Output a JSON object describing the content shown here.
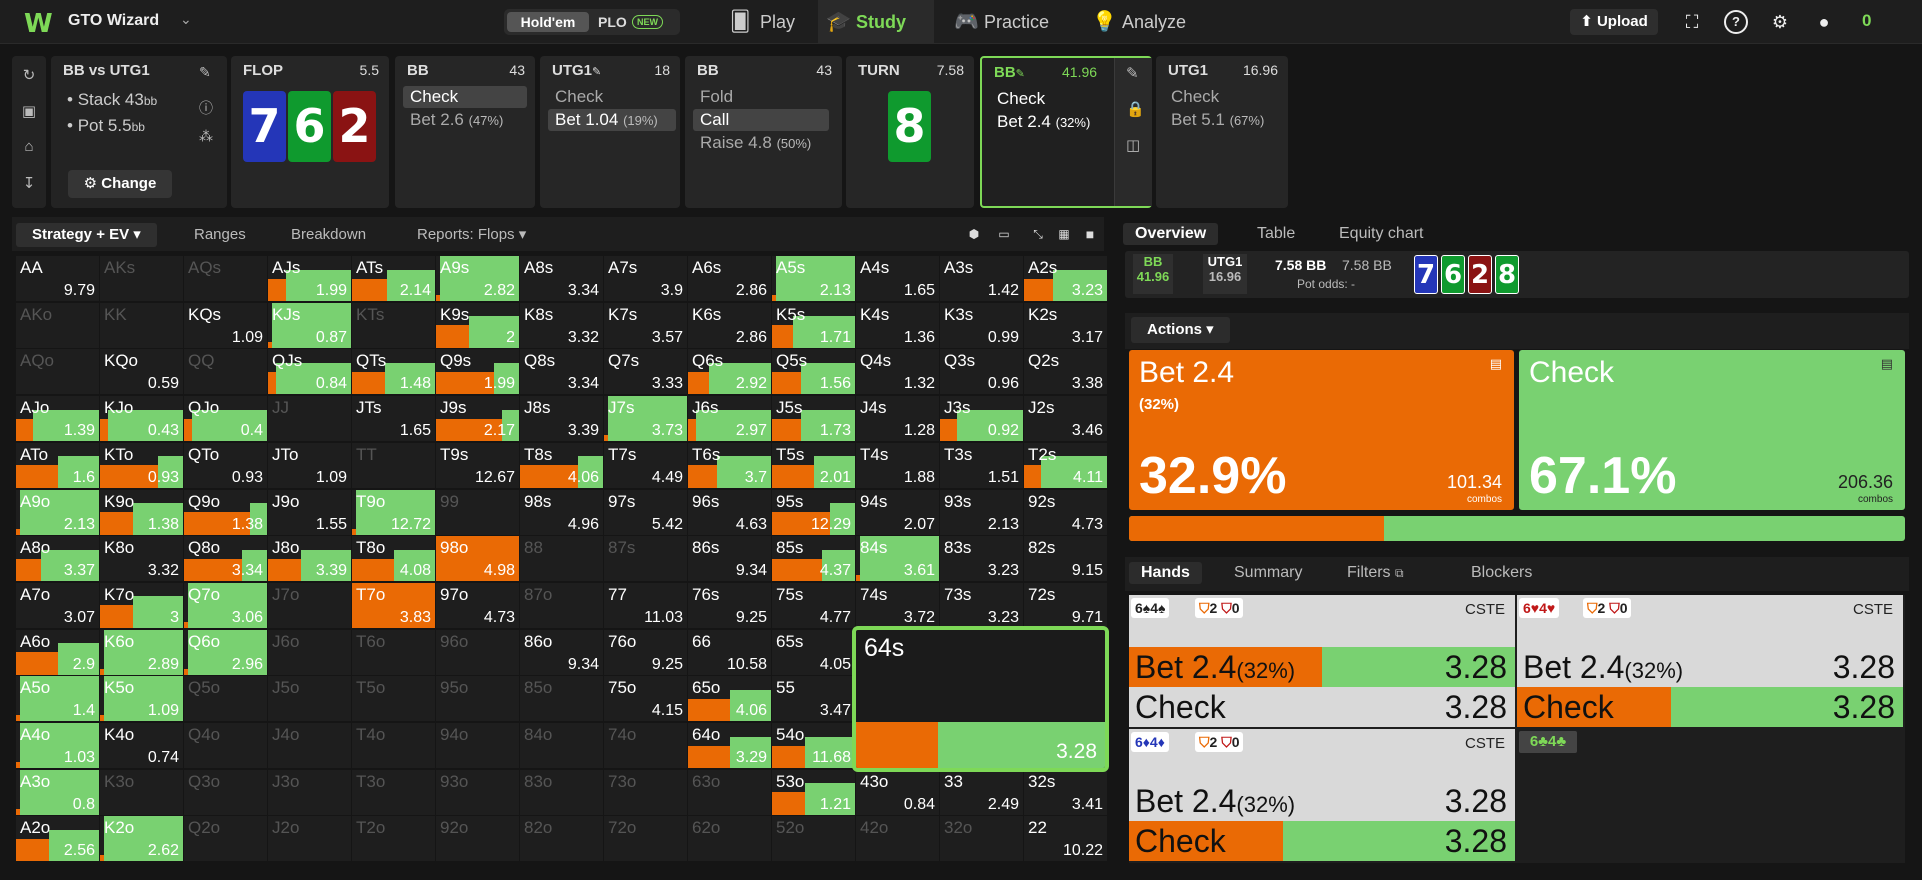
{
  "app": {
    "title": "GTO Wizard",
    "logo": "W"
  },
  "game_toggle": {
    "active": "Hold'em",
    "other": "PLO",
    "badge": "NEW"
  },
  "nav": [
    {
      "label": "Play"
    },
    {
      "label": "Study"
    },
    {
      "label": "Practice"
    },
    {
      "label": "Analyze"
    }
  ],
  "topright": {
    "upload": "Upload",
    "balance": "0"
  },
  "spot": {
    "title": "BB vs UTG1",
    "stack_label": "Stack 43",
    "stack_unit": "bb",
    "pot_label": "Pot 5.5",
    "pot_unit": "bb",
    "change": "Change"
  },
  "streets": [
    {
      "header": "FLOP",
      "value": "5.5"
    },
    {
      "header": "BB",
      "value": "43",
      "actions": [
        {
          "label": "Check",
          "pct": ""
        },
        {
          "label": "Bet 2.6",
          "pct": "(47%)"
        }
      ]
    },
    {
      "header": "UTG1",
      "value": "18",
      "actions": [
        {
          "label": "Check",
          "pct": ""
        },
        {
          "label": "Bet 1.04",
          "pct": "(19%)"
        }
      ]
    },
    {
      "header": "BB",
      "value": "43",
      "actions": [
        {
          "label": "Fold",
          "pct": ""
        },
        {
          "label": "Call",
          "pct": ""
        },
        {
          "label": "Raise 4.8",
          "pct": "(50%)"
        }
      ]
    },
    {
      "header": "TURN",
      "value": "7.58"
    },
    {
      "header": "BB",
      "value": "41.96",
      "actions": [
        {
          "label": "Check",
          "pct": ""
        },
        {
          "label": "Bet 2.4",
          "pct": "(32%)"
        }
      ]
    },
    {
      "header": "UTG1",
      "value": "16.96",
      "actions": [
        {
          "label": "Check",
          "pct": ""
        },
        {
          "label": "Bet 5.1",
          "pct": "(67%)"
        }
      ]
    }
  ],
  "board": {
    "flop": [
      "7",
      "6",
      "2"
    ],
    "turn": "8"
  },
  "left_tabs": {
    "strategy": "Strategy + EV",
    "ranges": "Ranges",
    "breakdown": "Breakdown",
    "reports": "Reports: Flops"
  },
  "grid": [
    [
      "AA",
      1,
      0,
      "9.79"
    ],
    [
      "AKs",
      0,
      0,
      ""
    ],
    [
      "AQs",
      0,
      0,
      ""
    ],
    [
      "AJs",
      1,
      0.22,
      "1.99"
    ],
    [
      "ATs",
      1,
      0.42,
      "2.14"
    ],
    [
      "A9s",
      1,
      0.05,
      "2.82"
    ],
    [
      "A8s",
      1,
      0,
      "3.34"
    ],
    [
      "A7s",
      1,
      0,
      "3.9"
    ],
    [
      "A6s",
      1,
      0,
      "2.86"
    ],
    [
      "A5s",
      1,
      0.05,
      "2.13"
    ],
    [
      "A4s",
      1,
      0,
      "1.65"
    ],
    [
      "A3s",
      1,
      0,
      "1.42"
    ],
    [
      "A2s",
      1,
      0.35,
      "3.23"
    ],
    [
      "AKo",
      0,
      0,
      ""
    ],
    [
      "KK",
      0,
      0,
      ""
    ],
    [
      "KQs",
      1,
      0,
      "1.09"
    ],
    [
      "KJs",
      1,
      0.05,
      "0.87"
    ],
    [
      "KTs",
      0,
      0,
      ""
    ],
    [
      "K9s",
      1,
      0.4,
      "2"
    ],
    [
      "K8s",
      1,
      0,
      "3.32"
    ],
    [
      "K7s",
      1,
      0,
      "3.57"
    ],
    [
      "K6s",
      1,
      0,
      "2.86"
    ],
    [
      "K5s",
      1,
      0.25,
      "1.71"
    ],
    [
      "K4s",
      1,
      0,
      "1.36"
    ],
    [
      "K3s",
      1,
      0,
      "0.99"
    ],
    [
      "K2s",
      1,
      0,
      "3.17"
    ],
    [
      "AQo",
      0,
      0,
      ""
    ],
    [
      "KQo",
      1,
      0,
      "0.59"
    ],
    [
      "QQ",
      0,
      0,
      ""
    ],
    [
      "QJs",
      1,
      0.1,
      "0.84"
    ],
    [
      "QTs",
      1,
      0.4,
      "1.48"
    ],
    [
      "Q9s",
      1,
      0.7,
      "1.99"
    ],
    [
      "Q8s",
      1,
      0,
      "3.34"
    ],
    [
      "Q7s",
      1,
      0,
      "3.33"
    ],
    [
      "Q6s",
      1,
      0.25,
      "2.92"
    ],
    [
      "Q5s",
      1,
      0.35,
      "1.56"
    ],
    [
      "Q4s",
      1,
      0,
      "1.32"
    ],
    [
      "Q3s",
      1,
      0,
      "0.96"
    ],
    [
      "Q2s",
      1,
      0,
      "3.38"
    ],
    [
      "AJo",
      1,
      0.2,
      "1.39"
    ],
    [
      "KJo",
      1,
      0.1,
      "0.43"
    ],
    [
      "QJo",
      1,
      0.1,
      "0.4"
    ],
    [
      "JJ",
      0,
      0,
      ""
    ],
    [
      "JTs",
      1,
      0,
      "1.65"
    ],
    [
      "J9s",
      1,
      0.8,
      "2.17"
    ],
    [
      "J8s",
      1,
      0,
      "3.39"
    ],
    [
      "J7s",
      1,
      0.05,
      "3.73"
    ],
    [
      "J6s",
      1,
      0.1,
      "2.97"
    ],
    [
      "J5s",
      1,
      0.35,
      "1.73"
    ],
    [
      "J4s",
      1,
      0,
      "1.28"
    ],
    [
      "J3s",
      1,
      0.2,
      "0.92"
    ],
    [
      "J2s",
      1,
      0,
      "3.46"
    ],
    [
      "ATo",
      1,
      0.5,
      "1.6"
    ],
    [
      "KTo",
      1,
      0.7,
      "0.93"
    ],
    [
      "QTo",
      1,
      0,
      "0.93"
    ],
    [
      "JTo",
      1,
      0,
      "1.09"
    ],
    [
      "TT",
      0,
      0,
      ""
    ],
    [
      "T9s",
      1,
      0,
      "12.67"
    ],
    [
      "T8s",
      1,
      0.7,
      "4.06"
    ],
    [
      "T7s",
      1,
      0,
      "4.49"
    ],
    [
      "T6s",
      1,
      0.35,
      "3.7"
    ],
    [
      "T5s",
      1,
      0.5,
      "2.01"
    ],
    [
      "T4s",
      1,
      0,
      "1.88"
    ],
    [
      "T3s",
      1,
      0,
      "1.51"
    ],
    [
      "T2s",
      1,
      0.2,
      "4.11"
    ],
    [
      "A9o",
      1,
      0.05,
      "2.13"
    ],
    [
      "K9o",
      1,
      0.4,
      "1.38"
    ],
    [
      "Q9o",
      1,
      0.8,
      "1.38"
    ],
    [
      "J9o",
      1,
      0,
      "1.55"
    ],
    [
      "T9o",
      1,
      0.05,
      "12.72"
    ],
    [
      "99",
      0,
      0,
      ""
    ],
    [
      "98s",
      1,
      0,
      "4.96"
    ],
    [
      "97s",
      1,
      0,
      "5.42"
    ],
    [
      "96s",
      1,
      0,
      "4.63"
    ],
    [
      "95s",
      1,
      0.7,
      "12.29"
    ],
    [
      "94s",
      1,
      0,
      "2.07"
    ],
    [
      "93s",
      1,
      0,
      "2.13"
    ],
    [
      "92s",
      1,
      0,
      "4.73"
    ],
    [
      "A8o",
      1,
      0.3,
      "3.37"
    ],
    [
      "K8o",
      1,
      0,
      "3.32"
    ],
    [
      "Q8o",
      1,
      0.7,
      "3.34"
    ],
    [
      "J8o",
      1,
      0.4,
      "3.39"
    ],
    [
      "T8o",
      1,
      0.5,
      "4.08"
    ],
    [
      "98o",
      1,
      1,
      "4.98"
    ],
    [
      "88",
      0,
      0,
      ""
    ],
    [
      "87s",
      0,
      0,
      ""
    ],
    [
      "86s",
      1,
      0,
      "9.34"
    ],
    [
      "85s",
      1,
      0.6,
      "4.37"
    ],
    [
      "84s",
      1,
      0.05,
      "3.61"
    ],
    [
      "83s",
      1,
      0,
      "3.23"
    ],
    [
      "82s",
      1,
      0,
      "9.15"
    ],
    [
      "A7o",
      1,
      0,
      "3.07"
    ],
    [
      "K7o",
      1,
      0.4,
      "3"
    ],
    [
      "Q7o",
      1,
      0.05,
      "3.06"
    ],
    [
      "J7o",
      0,
      0,
      ""
    ],
    [
      "T7o",
      1,
      1,
      "3.83"
    ],
    [
      "97o",
      1,
      0,
      "4.73"
    ],
    [
      "87o",
      0,
      0,
      ""
    ],
    [
      "77",
      1,
      0,
      "11.03"
    ],
    [
      "76s",
      1,
      0,
      "9.25"
    ],
    [
      "75s",
      1,
      0,
      "4.77"
    ],
    [
      "74s",
      1,
      0,
      "3.72"
    ],
    [
      "73s",
      1,
      0,
      "3.23"
    ],
    [
      "72s",
      1,
      0,
      "9.71"
    ],
    [
      "A6o",
      1,
      0.5,
      "2.9"
    ],
    [
      "K6o",
      1,
      0.05,
      "2.89"
    ],
    [
      "Q6o",
      1,
      0.05,
      "2.96"
    ],
    [
      "J6o",
      0,
      0,
      ""
    ],
    [
      "T6o",
      0,
      0,
      ""
    ],
    [
      "96o",
      0,
      0,
      ""
    ],
    [
      "86o",
      1,
      0,
      "9.34"
    ],
    [
      "76o",
      1,
      0,
      "9.25"
    ],
    [
      "66",
      1,
      0,
      "10.58"
    ],
    [
      "65s",
      1,
      0,
      "4.05"
    ],
    [
      "64s",
      1,
      0.33,
      "3.28"
    ],
    [
      "63s",
      1,
      0,
      ""
    ],
    [
      "62s",
      1,
      0,
      ""
    ],
    [
      "A5o",
      1,
      0.05,
      "1.4"
    ],
    [
      "K5o",
      1,
      0.05,
      "1.09"
    ],
    [
      "Q5o",
      0,
      0,
      ""
    ],
    [
      "J5o",
      0,
      0,
      ""
    ],
    [
      "T5o",
      0,
      0,
      ""
    ],
    [
      "95o",
      0,
      0,
      ""
    ],
    [
      "85o",
      0,
      0,
      ""
    ],
    [
      "75o",
      1,
      0,
      "4.15"
    ],
    [
      "65o",
      1,
      0.5,
      "4.06"
    ],
    [
      "55",
      1,
      0,
      "3.47"
    ],
    [
      "54s",
      1,
      0,
      ""
    ],
    [
      "53s",
      1,
      0,
      ""
    ],
    [
      "52s",
      1,
      0,
      ""
    ],
    [
      "A4o",
      1,
      0.05,
      "1.03"
    ],
    [
      "K4o",
      1,
      0,
      "0.74"
    ],
    [
      "Q4o",
      0,
      0,
      ""
    ],
    [
      "J4o",
      0,
      0,
      ""
    ],
    [
      "T4o",
      0,
      0,
      ""
    ],
    [
      "94o",
      0,
      0,
      ""
    ],
    [
      "84o",
      0,
      0,
      ""
    ],
    [
      "74o",
      0,
      0,
      ""
    ],
    [
      "64o",
      1,
      0.5,
      "3.29"
    ],
    [
      "54o",
      1,
      0.4,
      "11.68"
    ],
    [
      "44",
      1,
      0,
      ""
    ],
    [
      "43s",
      1,
      0,
      ""
    ],
    [
      "42s",
      1,
      0,
      ""
    ],
    [
      "A3o",
      1,
      0.05,
      "0.8"
    ],
    [
      "K3o",
      0,
      0,
      ""
    ],
    [
      "Q3o",
      0,
      0,
      ""
    ],
    [
      "J3o",
      0,
      0,
      ""
    ],
    [
      "T3o",
      0,
      0,
      ""
    ],
    [
      "93o",
      0,
      0,
      ""
    ],
    [
      "83o",
      0,
      0,
      ""
    ],
    [
      "73o",
      0,
      0,
      ""
    ],
    [
      "63o",
      0,
      0,
      ""
    ],
    [
      "53o",
      1,
      0.4,
      "1.21"
    ],
    [
      "43o",
      1,
      0,
      "0.84"
    ],
    [
      "33",
      1,
      0,
      "2.49"
    ],
    [
      "32s",
      1,
      0,
      "3.41"
    ],
    [
      "A2o",
      1,
      0.4,
      "2.56"
    ],
    [
      "K2o",
      1,
      0.05,
      "2.62"
    ],
    [
      "Q2o",
      0,
      0,
      ""
    ],
    [
      "J2o",
      0,
      0,
      ""
    ],
    [
      "T2o",
      0,
      0,
      ""
    ],
    [
      "92o",
      0,
      0,
      ""
    ],
    [
      "82o",
      0,
      0,
      ""
    ],
    [
      "72o",
      0,
      0,
      ""
    ],
    [
      "62o",
      0,
      0,
      ""
    ],
    [
      "52o",
      0,
      0,
      ""
    ],
    [
      "42o",
      0,
      0,
      ""
    ],
    [
      "32o",
      0,
      0,
      ""
    ],
    [
      "22",
      1,
      0,
      "10.22"
    ]
  ],
  "popup": {
    "hand": "64s",
    "ev": "3.28",
    "bet_frac": 0.33
  },
  "right_tabs": {
    "overview": "Overview",
    "table": "Table",
    "equity": "Equity chart"
  },
  "overview": {
    "p1": "BB",
    "p1_val": "41.96",
    "p2": "UTG1",
    "p2_val": "16.96",
    "pot": "7.58 BB",
    "pot2": "7.58 BB",
    "pot_odds_label": "Pot odds:",
    "pot_odds": "-"
  },
  "actions_dd": "Actions",
  "bet": {
    "label": "Bet 2.4",
    "size": "(32%)",
    "freq": "32.9%",
    "combos": "101.34",
    "combos_label": "combos",
    "frac": 0.329
  },
  "check": {
    "label": "Check",
    "freq": "67.1%",
    "combos": "206.36",
    "combos_label": "combos",
    "frac": 0.671
  },
  "hands_tabs": {
    "hands": "Hands",
    "summary": "Summary",
    "filters": "Filters",
    "blockers": "Blockers"
  },
  "hands": [
    {
      "cards": "6♠4♠",
      "c1": "2",
      "c2": "0",
      "cste": "CSTE",
      "bet": "Bet 2.4",
      "bet_pct": "(32%)",
      "bet_ev": "3.28",
      "check": "Check",
      "check_ev": "3.28",
      "bet_frac": 0.5,
      "check_frac": 0.5
    },
    {
      "cards": "6♥4♥",
      "c1": "2",
      "c2": "0",
      "cste": "CSTE",
      "bet": "Bet 2.4",
      "bet_pct": "(32%)",
      "bet_ev": "3.28",
      "check": "Check",
      "check_ev": "3.28",
      "bet_frac": 0.0,
      "check_frac": 0.4
    },
    {
      "cards": "6♦4♦",
      "c1": "2",
      "c2": "0",
      "cste": "CSTE",
      "bet": "Bet 2.4",
      "bet_pct": "(32%)",
      "bet_ev": "3.28",
      "check": "Check",
      "check_ev": "3.28",
      "bet_frac": 0.0,
      "check_frac": 0.4
    },
    {
      "cards": "6♣4♣"
    }
  ],
  "colors": {
    "bet": "#ea6a05",
    "check": "#79d171",
    "accent": "#7ed957"
  }
}
